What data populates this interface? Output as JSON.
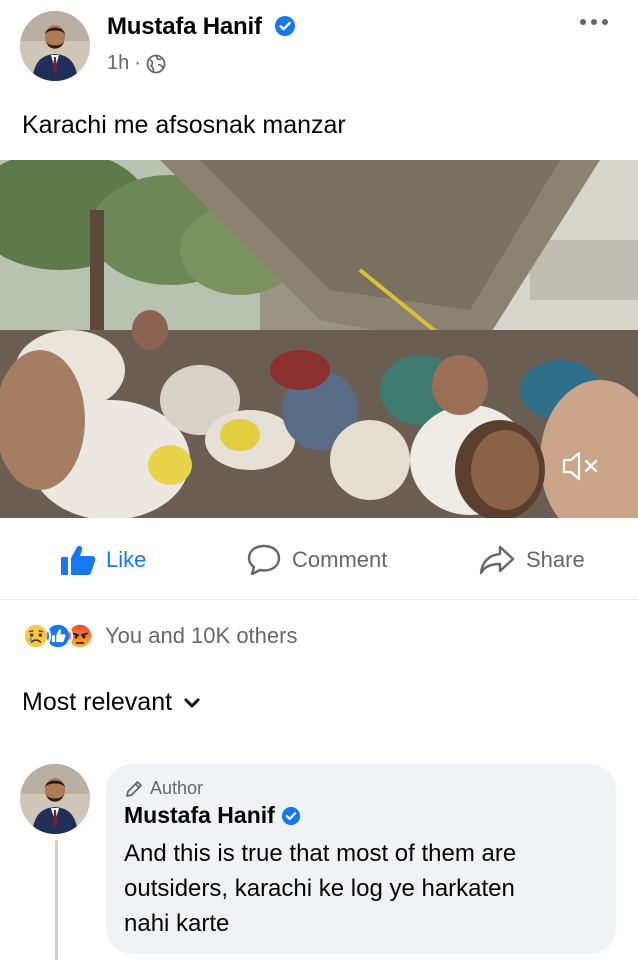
{
  "post": {
    "author": "Mustafa Hanif",
    "time": "1h",
    "separator": "·",
    "text": "Karachi me afsosnak manzar",
    "verified": true,
    "privacy_icon": "globe-icon",
    "more_icon": "more-horizontal-icon"
  },
  "actions": {
    "like": "Like",
    "comment": "Comment",
    "share": "Share"
  },
  "reactions": {
    "icons": [
      "sad-icon",
      "like-icon",
      "angry-icon"
    ],
    "summary": "You and 10K others"
  },
  "comments_sort": {
    "label": "Most relevant",
    "icon": "chevron-down-icon"
  },
  "comment": {
    "badge": "Author",
    "badge_icon": "pencil-icon",
    "author": "Mustafa Hanif",
    "verified": true,
    "text_lines": [
      "And this is true that most of them are",
      "outsiders, karachi ke log ye harkaten",
      "nahi karte"
    ]
  },
  "colors": {
    "facebook_blue": "#1877f2",
    "secondary_text": "#65676b",
    "comment_bg": "#f0f2f5"
  }
}
